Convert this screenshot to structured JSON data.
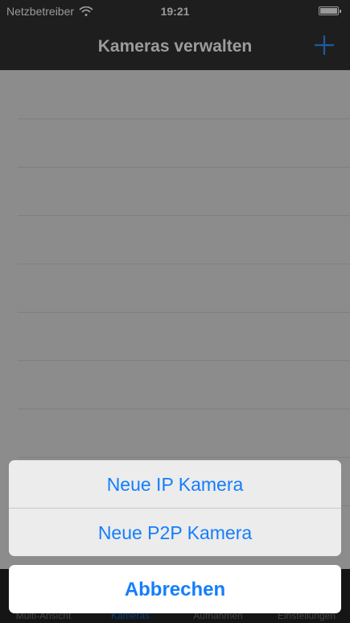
{
  "status_bar": {
    "carrier": "Netzbetreiber",
    "time": "19:21",
    "wifi_icon": "wifi-icon",
    "battery_icon": "battery-icon"
  },
  "nav": {
    "title": "Kameras verwalten",
    "add_icon": "plus-icon",
    "accent_color": "#157efb"
  },
  "tabs": [
    {
      "label": "Multi-Ansicht",
      "active": false
    },
    {
      "label": "Kameras",
      "active": true
    },
    {
      "label": "Aufnahmen",
      "active": false
    },
    {
      "label": "Einstellungen",
      "active": false
    }
  ],
  "action_sheet": {
    "options": [
      {
        "label": "Neue IP Kamera"
      },
      {
        "label": "Neue P2P Kamera"
      }
    ],
    "cancel_label": "Abbrechen"
  }
}
